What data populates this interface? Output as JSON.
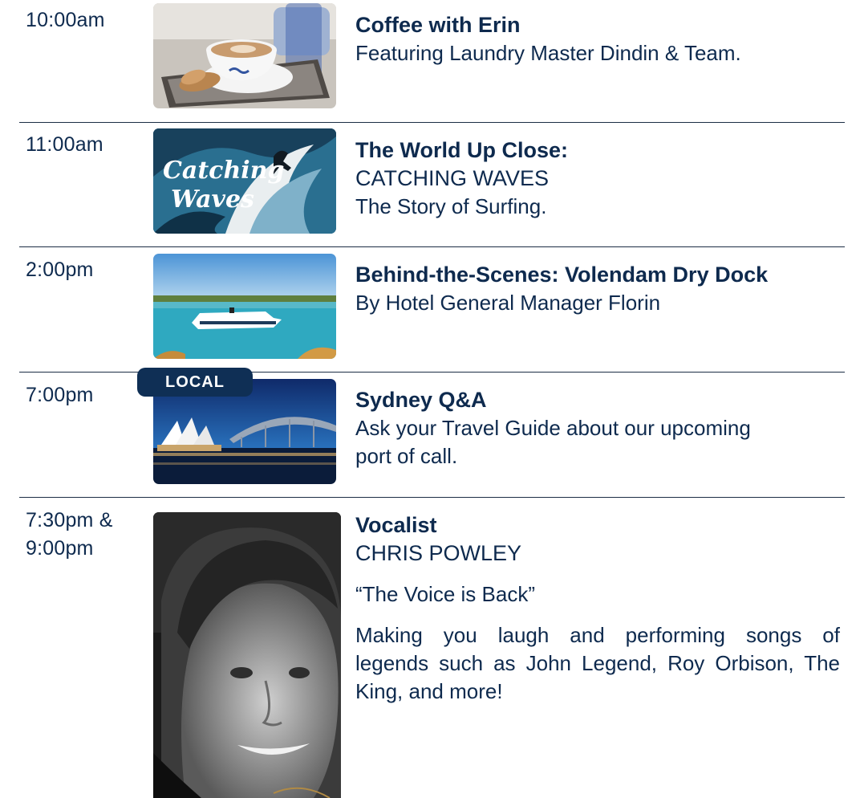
{
  "events": [
    {
      "time": "10:00am",
      "title": "Coffee with Erin",
      "description": "Featuring Laundry Master Dindin & Team."
    },
    {
      "time": "11:00am",
      "title_line1": "The World Up Close:",
      "title_line2": "CATCHING WAVES",
      "description": "The Story of Surfing.",
      "image_text_line1": "Catching",
      "image_text_line2": "Waves"
    },
    {
      "time": "2:00pm",
      "title": "Behind-the-Scenes: Volendam Dry Dock",
      "description": "By Hotel General Manager Florin"
    },
    {
      "time": "7:00pm",
      "badge": "LOCAL",
      "title": "Sydney Q&A",
      "description_line1": "Ask your Travel Guide about our upcoming",
      "description_line2": "port of call."
    },
    {
      "time_line1": "7:30pm &",
      "time_line2": "9:00pm",
      "title_line1": "Vocalist",
      "title_line2": "CHRIS POWLEY",
      "quote": "“The Voice is Back”",
      "description_line1": "Making you laugh and performing songs of",
      "description_line2": "legends such as John Legend, Roy Orbison, The",
      "description_line3": "King, and more!"
    }
  ],
  "colors": {
    "text": "#0e2a4e",
    "badge_bg": "#0f2f55",
    "divider": "#1c2e45"
  }
}
